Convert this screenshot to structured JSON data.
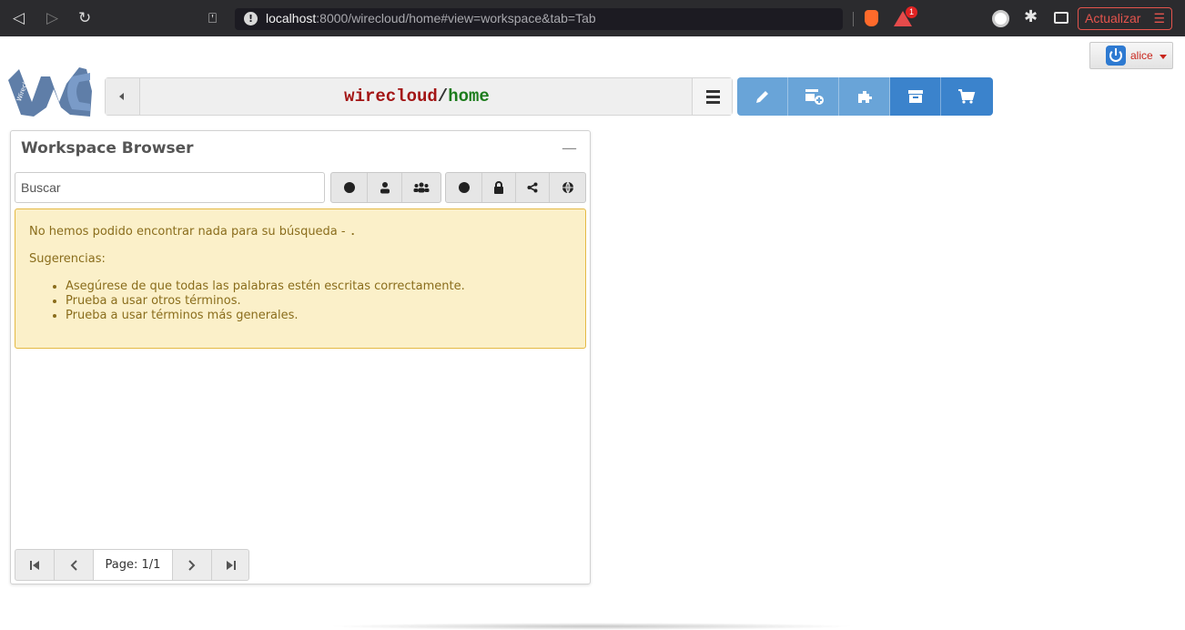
{
  "browser": {
    "url_host": "localhost",
    "url_rest": ":8000/wirecloud/home#view=workspace&tab=Tab",
    "notification_count": "1",
    "update_label": "Actualizar"
  },
  "user": {
    "name": "alice"
  },
  "header": {
    "owner": "wirecloud",
    "separator": "/",
    "workspace": "home"
  },
  "panel": {
    "title": "Workspace Browser",
    "search_placeholder": "Buscar",
    "alert": {
      "message": "No hemos podido encontrar nada para su búsqueda - ",
      "query": ".",
      "suggestions_title": "Sugerencias:",
      "suggestions": [
        "Asegúrese de que todas las palabras estén escritas correctamente.",
        "Prueba a usar otros términos.",
        "Prueba a usar términos más generales."
      ]
    },
    "pagination": {
      "label": "Page: 1/1"
    }
  },
  "colors": {
    "alert_bg": "#fbf0c9",
    "alert_border": "#e4b944",
    "alert_text": "#8a6d1c",
    "toolbar_light": "#69a4d8",
    "toolbar_dark": "#3b83cc",
    "owner_color": "#a31515",
    "workspace_color": "#1c7c1c"
  },
  "icons": {
    "toolbar": [
      "pencil-icon",
      "add-widget-icon",
      "puzzle-icon",
      "archive-icon",
      "cart-icon"
    ],
    "filters": [
      "all-owners-icon",
      "user-icon",
      "group-icon",
      "all-visibility-icon",
      "lock-icon",
      "share-icon",
      "globe-icon"
    ]
  }
}
